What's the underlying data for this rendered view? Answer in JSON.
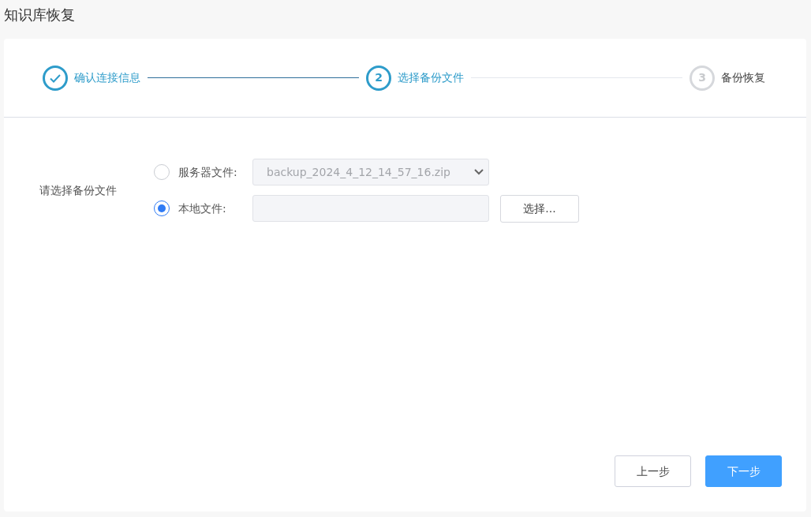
{
  "page_title": "知识库恢复",
  "steps": [
    {
      "label": "确认连接信息",
      "kind": "done"
    },
    {
      "number": "2",
      "label": "选择备份文件",
      "kind": "current"
    },
    {
      "number": "3",
      "label": "备份恢复",
      "kind": "pending"
    }
  ],
  "form": {
    "label": "请选择备份文件",
    "options": [
      {
        "kind": "select",
        "label": "服务器文件:",
        "selected": false,
        "value": "backup_2024_4_12_14_57_16.zip"
      },
      {
        "kind": "file",
        "label": "本地文件:",
        "selected": true,
        "button": "选择..."
      }
    ]
  },
  "buttons": [
    {
      "label": "上一步",
      "kind": "secondary"
    },
    {
      "label": "下一步",
      "kind": "primary"
    }
  ]
}
